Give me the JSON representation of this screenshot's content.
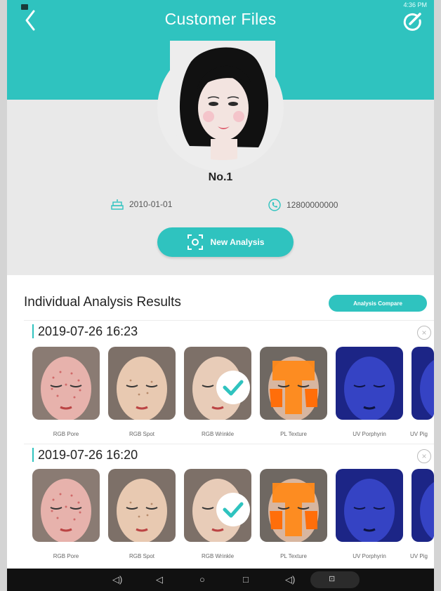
{
  "status": {
    "time": "4:36 PM"
  },
  "header": {
    "title": "Customer Files"
  },
  "profile": {
    "name": "No.1",
    "birthdate": "2010-01-01",
    "phone": "12800000000"
  },
  "actions": {
    "new_analysis": "New Analysis",
    "analysis_compare": "Analysis Compare"
  },
  "results": {
    "title": "Individual Analysis Results",
    "sessions": [
      {
        "datetime": "2019-07-26 16:23",
        "items": [
          {
            "label": "RGB Pore"
          },
          {
            "label": "RGB Spot"
          },
          {
            "label": "RGB Wrinkle"
          },
          {
            "label": "PL Texture"
          },
          {
            "label": "UV Porphyrin"
          },
          {
            "label": "UV Pig"
          }
        ]
      },
      {
        "datetime": "2019-07-26 16:20",
        "items": [
          {
            "label": "RGB Pore"
          },
          {
            "label": "RGB Spot"
          },
          {
            "label": "RGB Wrinkle"
          },
          {
            "label": "PL Texture"
          },
          {
            "label": "UV Porphyrin"
          },
          {
            "label": "UV Pig"
          }
        ]
      }
    ]
  },
  "colors": {
    "accent": "#2fc3bf",
    "uv": "#2733a8",
    "pl": "#ff8a1a"
  },
  "icons": [
    "back-arrow-icon",
    "edit-icon",
    "cake-icon",
    "phone-icon",
    "camera-focus-icon",
    "close-icon",
    "check-icon"
  ]
}
